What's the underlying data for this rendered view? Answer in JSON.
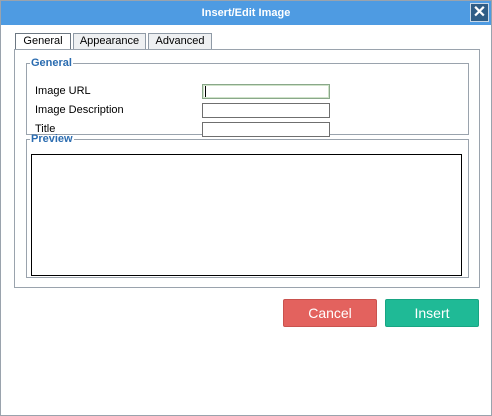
{
  "dialog": {
    "title": "Insert/Edit Image",
    "close_symbol": "✕"
  },
  "tabs": [
    {
      "label": "General",
      "active": true
    },
    {
      "label": "Appearance",
      "active": false
    },
    {
      "label": "Advanced",
      "active": false
    }
  ],
  "general": {
    "legend": "General",
    "fields": [
      {
        "label": "Image URL",
        "value": ""
      },
      {
        "label": "Image Description",
        "value": ""
      },
      {
        "label": "Title",
        "value": ""
      }
    ]
  },
  "preview": {
    "legend": "Preview"
  },
  "buttons": {
    "cancel": "Cancel",
    "insert": "Insert"
  },
  "colors": {
    "titlebar": "#4e9be2",
    "cancel": "#e3625e",
    "insert": "#1fba96",
    "legend": "#2b6cb0"
  },
  "icons": {
    "close": "close-icon"
  }
}
